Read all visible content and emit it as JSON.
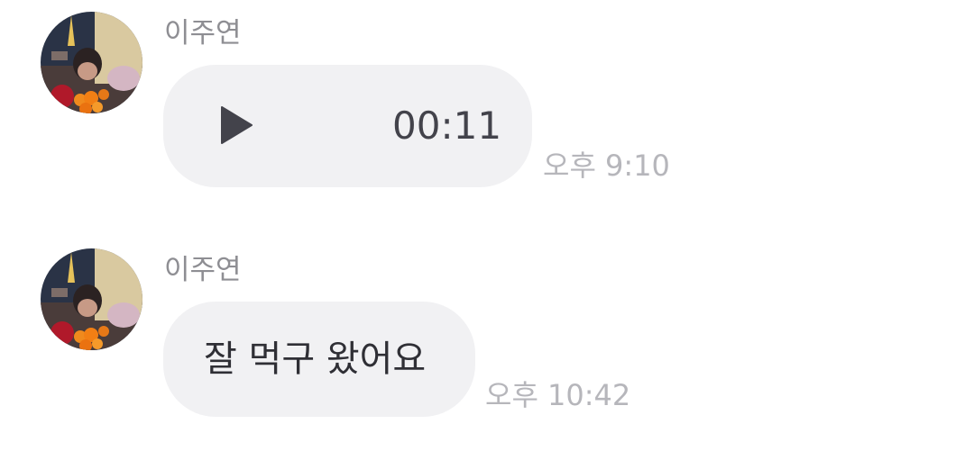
{
  "messages": [
    {
      "sender": "이주연",
      "type": "voice",
      "duration": "00:11",
      "time": "오후 9:10",
      "avatar_icon": "profile-photo"
    },
    {
      "sender": "이주연",
      "type": "text",
      "text": "잘 먹구 왔어요",
      "time": "오후 10:42",
      "avatar_icon": "profile-photo"
    }
  ],
  "colors": {
    "bubble": "#f1f1f3",
    "sender": "#8e8e93",
    "timestamp": "#b6b6bb",
    "message_text": "#2f2f35",
    "play_icon": "#43434b"
  }
}
